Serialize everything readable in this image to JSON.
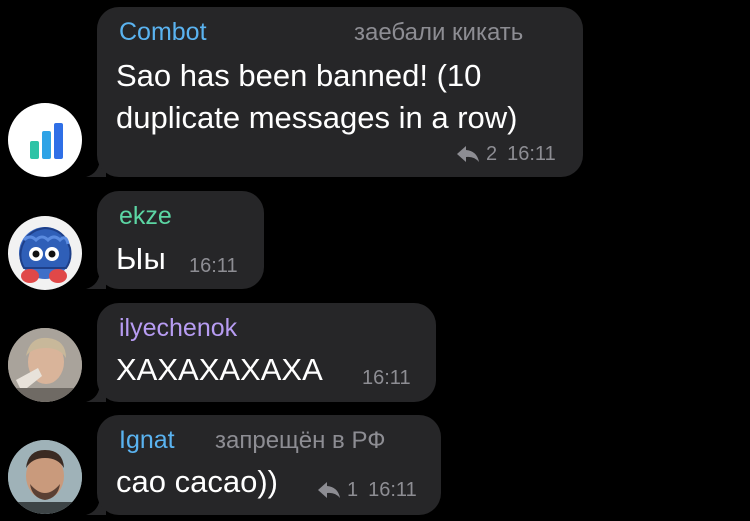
{
  "messages": [
    {
      "sender": "Combot",
      "sender_color": "#5ab3f0",
      "title": "заебали кикать",
      "text_lines": [
        "Sao has been banned! (10",
        "duplicate messages in a row)"
      ],
      "replies": "2",
      "time": "16:11",
      "avatar_icon": "bar-chart-icon"
    },
    {
      "sender": "ekze",
      "sender_color": "#5cd6a4",
      "text": "Ыы",
      "time": "16:11",
      "avatar_icon": "monster-avatar-icon"
    },
    {
      "sender": "ilyechenok",
      "sender_color": "#b79cf2",
      "text": "ХАХАХАХАХА",
      "time": "16:11",
      "avatar_icon": "person-photo-icon"
    },
    {
      "sender": "Ignat",
      "sender_color": "#5ab3f0",
      "title": "запрещён в РФ",
      "text": "сао сасао))",
      "replies": "1",
      "time": "16:11",
      "avatar_icon": "person-photo-icon"
    }
  ]
}
